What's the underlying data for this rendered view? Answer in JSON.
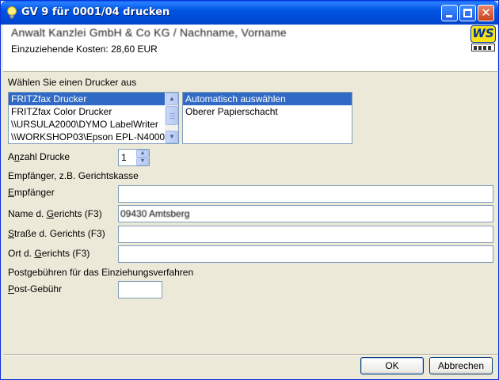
{
  "window": {
    "title": "GV 9 für 0001/04 drucken",
    "controls": {
      "minimize_icon": "minimize-icon",
      "maximize_icon": "maximize-icon",
      "close_icon": "close-icon",
      "close_glyph": "✕"
    }
  },
  "header": {
    "name": "Anwalt Kanzlei GmbH & Co KG / Nachname, Vorname",
    "cost": "Einzuziehende Kosten: 28,60 EUR",
    "logo_text": "WS"
  },
  "printer_section": {
    "heading": "Wählen Sie einen Drucker aus",
    "printers": [
      "FRITZfax Drucker",
      "FRITZfax Color Drucker",
      "\\\\URSULA2000\\DYMO LabelWriter",
      "\\\\WORKSHOP03\\Epson EPL-N4000"
    ],
    "selected_printer_index": 0,
    "trays": [
      "Automatisch auswählen",
      "Oberer Papierschacht"
    ],
    "selected_tray_index": 0
  },
  "copies": {
    "label_pre": "A",
    "label_u": "n",
    "label_post": "zahl Drucke",
    "value": "1"
  },
  "recipient_section": {
    "heading": "Empfänger, z.B. Gerichtskasse",
    "fields": [
      {
        "label_pre": "",
        "label_u": "E",
        "label_post": "mpfänger",
        "value": ""
      },
      {
        "label_pre": "Name d. ",
        "label_u": "G",
        "label_post": "erichts (F3)",
        "value": "09430 Amtsberg"
      },
      {
        "label_pre": "",
        "label_u": "S",
        "label_post": "traße d. Gerichts (F3)",
        "value": ""
      },
      {
        "label_pre": "Ort d. ",
        "label_u": "G",
        "label_post": "erichts (F3)",
        "value": ""
      }
    ]
  },
  "postage_section": {
    "heading": "Postgebühren für das Einziehungsverfahren",
    "label_pre": "",
    "label_u": "P",
    "label_post": "ost-Gebühr",
    "value": ""
  },
  "buttons": {
    "ok": "OK",
    "cancel": "Abbrechen"
  },
  "colors": {
    "selection": "#316AC5",
    "titlebar": "#0054E3",
    "dialog_bg": "#ECE9D8"
  }
}
